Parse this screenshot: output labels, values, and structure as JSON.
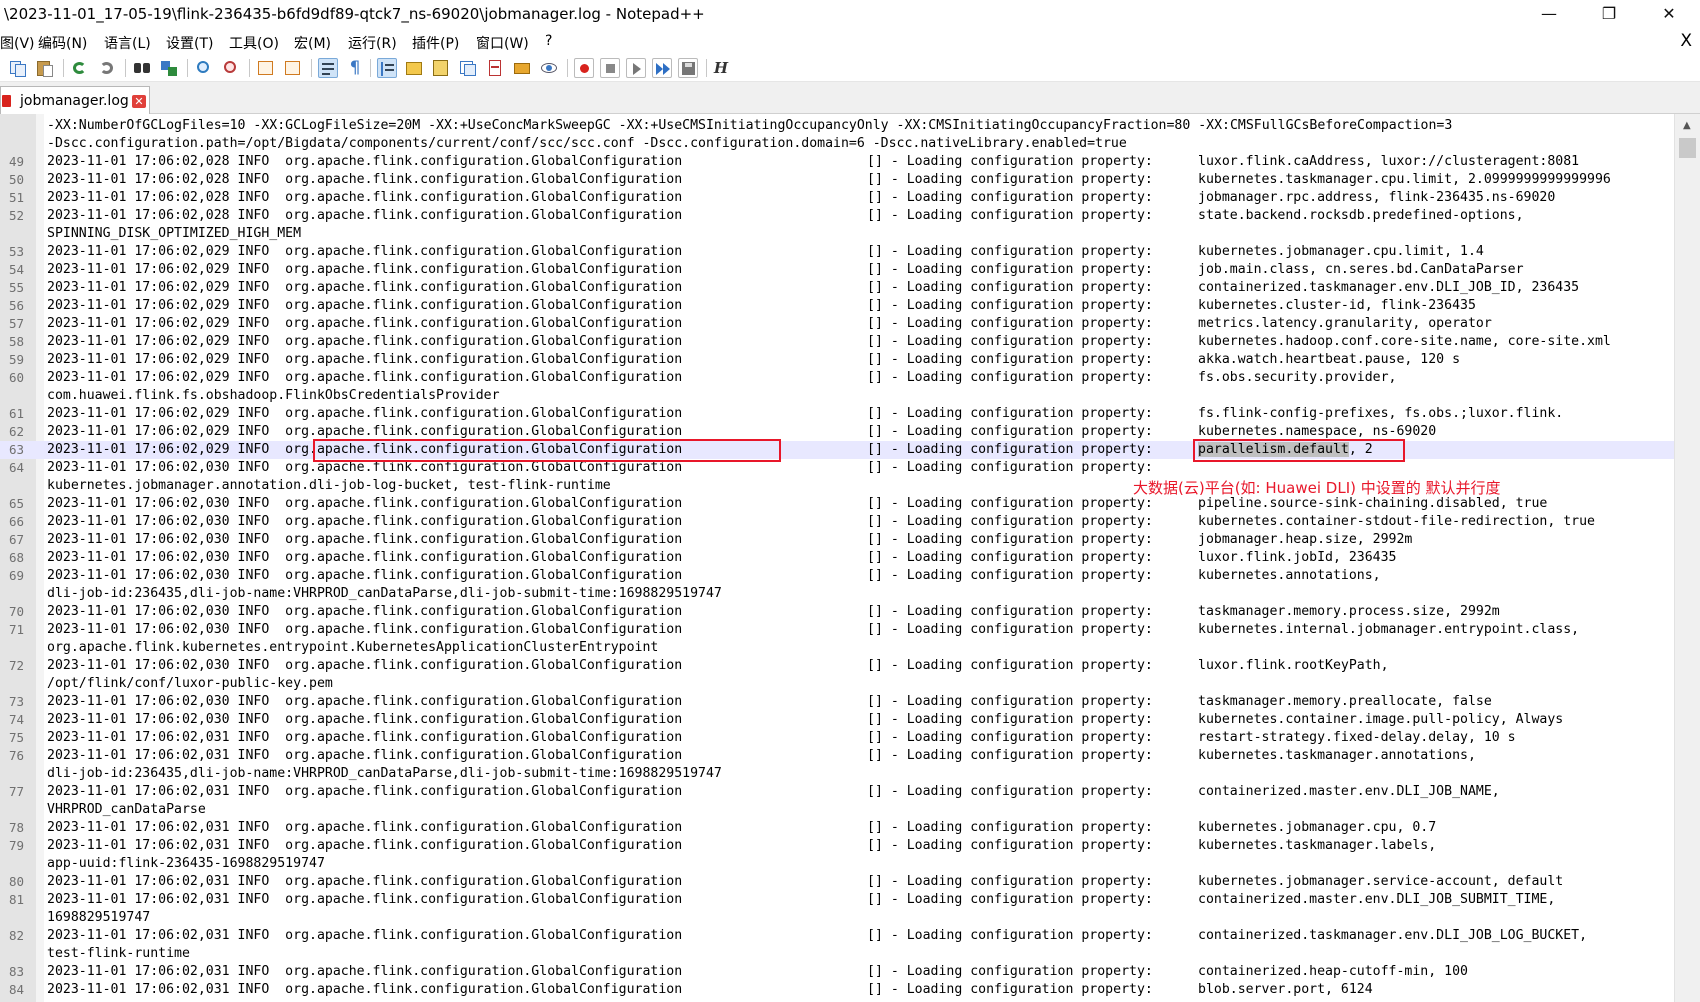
{
  "window": {
    "title": "\\2023-11-01_17-05-19\\flink-236435-b6fd9df89-qtck7_ns-69020\\jobmanager.log - Notepad++",
    "minimize_glyph": "—",
    "maximize_glyph": "❐",
    "close_glyph": "✕"
  },
  "menu": {
    "items": [
      "图(V)",
      "编码(N)",
      "语言(L)",
      "设置(T)",
      "工具(O)",
      "宏(M)",
      "运行(R)",
      "插件(P)",
      "窗口(W)",
      "?"
    ],
    "doc_close_glyph": "X"
  },
  "toolbar": {
    "icons": [
      "copy-icon",
      "paste-icon",
      "undo-icon",
      "redo-icon",
      "find-icon",
      "replace-icon",
      "zoom-in-icon",
      "zoom-out-icon",
      "sync-vertical-icon",
      "sync-horizontal-icon",
      "word-wrap-icon",
      "show-all-characters-icon",
      "indent-guide-icon",
      "user-defined-language-icon",
      "document-map-icon",
      "document-list-icon",
      "function-list-icon",
      "folder-as-workspace-icon",
      "monitoring-icon",
      "record-macro-icon",
      "stop-recording-icon",
      "playback-macro-icon",
      "run-macro-multiple-icon",
      "save-macro-icon",
      "hex-editor-icon"
    ],
    "hex_label": "H"
  },
  "tab": {
    "label": "jobmanager.log",
    "close_glyph": "✕"
  },
  "log": {
    "lines": [
      {
        "n": "",
        "text": "-XX:NumberOfGCLogFiles=10 -XX:GCLogFileSize=20M -XX:+UseConcMarkSweepGC -XX:+UseCMSInitiatingOccupancyOnly -XX:CMSInitiatingOccupancyFraction=80 -XX:CMSFullGCsBeforeCompaction=3"
      },
      {
        "n": "",
        "text": "-Dscc.configuration.path=/opt/Bigdata/components/current/conf/scc/scc.conf -Dscc.configuration.domain=6 -Dscc.nativeLibrary.enabled=true"
      },
      {
        "n": "49",
        "c1": "2023-11-01 17:06:02,028 INFO  org.apache.flink.configuration.GlobalConfiguration",
        "c2": "[] - Loading configuration property:",
        "c3": "luxor.flink.caAddress, luxor://clusteragent:8081"
      },
      {
        "n": "50",
        "c1": "2023-11-01 17:06:02,028 INFO  org.apache.flink.configuration.GlobalConfiguration",
        "c2": "[] - Loading configuration property:",
        "c3": "kubernetes.taskmanager.cpu.limit, 2.0999999999999996"
      },
      {
        "n": "51",
        "c1": "2023-11-01 17:06:02,028 INFO  org.apache.flink.configuration.GlobalConfiguration",
        "c2": "[] - Loading configuration property:",
        "c3": "jobmanager.rpc.address, flink-236435.ns-69020"
      },
      {
        "n": "52",
        "c1": "2023-11-01 17:06:02,028 INFO  org.apache.flink.configuration.GlobalConfiguration",
        "c2": "[] - Loading configuration property:",
        "c3": "state.backend.rocksdb.predefined-options,"
      },
      {
        "n": "",
        "text": "SPINNING_DISK_OPTIMIZED_HIGH_MEM"
      },
      {
        "n": "53",
        "c1": "2023-11-01 17:06:02,029 INFO  org.apache.flink.configuration.GlobalConfiguration",
        "c2": "[] - Loading configuration property:",
        "c3": "kubernetes.jobmanager.cpu.limit, 1.4"
      },
      {
        "n": "54",
        "c1": "2023-11-01 17:06:02,029 INFO  org.apache.flink.configuration.GlobalConfiguration",
        "c2": "[] - Loading configuration property:",
        "c3": "job.main.class, cn.seres.bd.CanDataParser"
      },
      {
        "n": "55",
        "c1": "2023-11-01 17:06:02,029 INFO  org.apache.flink.configuration.GlobalConfiguration",
        "c2": "[] - Loading configuration property:",
        "c3": "containerized.taskmanager.env.DLI_JOB_ID, 236435"
      },
      {
        "n": "56",
        "c1": "2023-11-01 17:06:02,029 INFO  org.apache.flink.configuration.GlobalConfiguration",
        "c2": "[] - Loading configuration property:",
        "c3": "kubernetes.cluster-id, flink-236435"
      },
      {
        "n": "57",
        "c1": "2023-11-01 17:06:02,029 INFO  org.apache.flink.configuration.GlobalConfiguration",
        "c2": "[] - Loading configuration property:",
        "c3": "metrics.latency.granularity, operator"
      },
      {
        "n": "58",
        "c1": "2023-11-01 17:06:02,029 INFO  org.apache.flink.configuration.GlobalConfiguration",
        "c2": "[] - Loading configuration property:",
        "c3": "kubernetes.hadoop.conf.core-site.name, core-site.xml"
      },
      {
        "n": "59",
        "c1": "2023-11-01 17:06:02,029 INFO  org.apache.flink.configuration.GlobalConfiguration",
        "c2": "[] - Loading configuration property:",
        "c3": "akka.watch.heartbeat.pause, 120 s"
      },
      {
        "n": "60",
        "c1": "2023-11-01 17:06:02,029 INFO  org.apache.flink.configuration.GlobalConfiguration",
        "c2": "[] - Loading configuration property:",
        "c3": "fs.obs.security.provider,"
      },
      {
        "n": "",
        "text": "com.huawei.flink.fs.obshadoop.FlinkObsCredentialsProvider"
      },
      {
        "n": "61",
        "c1": "2023-11-01 17:06:02,029 INFO  org.apache.flink.configuration.GlobalConfiguration",
        "c2": "[] - Loading configuration property:",
        "c3": "fs.flink-config-prefixes, fs.obs.;luxor.flink."
      },
      {
        "n": "62",
        "c1": "2023-11-01 17:06:02,029 INFO  org.apache.flink.configuration.GlobalConfiguration",
        "c2": "[] - Loading configuration property:",
        "c3": "kubernetes.namespace, ns-69020"
      },
      {
        "n": "63",
        "c1": "2023-11-01 17:06:02,029 INFO  org.apache.flink.configuration.GlobalConfiguration",
        "c2": "[] - Loading configuration property:",
        "c3_sel": "parallelism.default",
        "c3_rest": ", 2",
        "current": true
      },
      {
        "n": "64",
        "c1": "2023-11-01 17:06:02,030 INFO  org.apache.flink.configuration.GlobalConfiguration",
        "c2": "[] - Loading configuration property:",
        "c3": ""
      },
      {
        "n": "",
        "text": "kubernetes.jobmanager.annotation.dli-job-log-bucket, test-flink-runtime"
      },
      {
        "n": "65",
        "c1": "2023-11-01 17:06:02,030 INFO  org.apache.flink.configuration.GlobalConfiguration",
        "c2": "[] - Loading configuration property:",
        "c3": "pipeline.source-sink-chaining.disabled, true"
      },
      {
        "n": "66",
        "c1": "2023-11-01 17:06:02,030 INFO  org.apache.flink.configuration.GlobalConfiguration",
        "c2": "[] - Loading configuration property:",
        "c3": "kubernetes.container-stdout-file-redirection, true"
      },
      {
        "n": "67",
        "c1": "2023-11-01 17:06:02,030 INFO  org.apache.flink.configuration.GlobalConfiguration",
        "c2": "[] - Loading configuration property:",
        "c3": "jobmanager.heap.size, 2992m"
      },
      {
        "n": "68",
        "c1": "2023-11-01 17:06:02,030 INFO  org.apache.flink.configuration.GlobalConfiguration",
        "c2": "[] - Loading configuration property:",
        "c3": "luxor.flink.jobId, 236435"
      },
      {
        "n": "69",
        "c1": "2023-11-01 17:06:02,030 INFO  org.apache.flink.configuration.GlobalConfiguration",
        "c2": "[] - Loading configuration property:",
        "c3": "kubernetes.annotations,"
      },
      {
        "n": "",
        "text": "dli-job-id:236435,dli-job-name:VHRPROD_canDataParse,dli-job-submit-time:1698829519747"
      },
      {
        "n": "70",
        "c1": "2023-11-01 17:06:02,030 INFO  org.apache.flink.configuration.GlobalConfiguration",
        "c2": "[] - Loading configuration property:",
        "c3": "taskmanager.memory.process.size, 2992m"
      },
      {
        "n": "71",
        "c1": "2023-11-01 17:06:02,030 INFO  org.apache.flink.configuration.GlobalConfiguration",
        "c2": "[] - Loading configuration property:",
        "c3": "kubernetes.internal.jobmanager.entrypoint.class,"
      },
      {
        "n": "",
        "text": "org.apache.flink.kubernetes.entrypoint.KubernetesApplicationClusterEntrypoint"
      },
      {
        "n": "72",
        "c1": "2023-11-01 17:06:02,030 INFO  org.apache.flink.configuration.GlobalConfiguration",
        "c2": "[] - Loading configuration property:",
        "c3": "luxor.flink.rootKeyPath,"
      },
      {
        "n": "",
        "text": "/opt/flink/conf/luxor-public-key.pem"
      },
      {
        "n": "73",
        "c1": "2023-11-01 17:06:02,030 INFO  org.apache.flink.configuration.GlobalConfiguration",
        "c2": "[] - Loading configuration property:",
        "c3": "taskmanager.memory.preallocate, false"
      },
      {
        "n": "74",
        "c1": "2023-11-01 17:06:02,030 INFO  org.apache.flink.configuration.GlobalConfiguration",
        "c2": "[] - Loading configuration property:",
        "c3": "kubernetes.container.image.pull-policy, Always"
      },
      {
        "n": "75",
        "c1": "2023-11-01 17:06:02,031 INFO  org.apache.flink.configuration.GlobalConfiguration",
        "c2": "[] - Loading configuration property:",
        "c3": "restart-strategy.fixed-delay.delay, 10 s"
      },
      {
        "n": "76",
        "c1": "2023-11-01 17:06:02,031 INFO  org.apache.flink.configuration.GlobalConfiguration",
        "c2": "[] - Loading configuration property:",
        "c3": "kubernetes.taskmanager.annotations,"
      },
      {
        "n": "",
        "text": "dli-job-id:236435,dli-job-name:VHRPROD_canDataParse,dli-job-submit-time:1698829519747"
      },
      {
        "n": "77",
        "c1": "2023-11-01 17:06:02,031 INFO  org.apache.flink.configuration.GlobalConfiguration",
        "c2": "[] - Loading configuration property:",
        "c3": "containerized.master.env.DLI_JOB_NAME,"
      },
      {
        "n": "",
        "text": "VHRPROD_canDataParse"
      },
      {
        "n": "78",
        "c1": "2023-11-01 17:06:02,031 INFO  org.apache.flink.configuration.GlobalConfiguration",
        "c2": "[] - Loading configuration property:",
        "c3": "kubernetes.jobmanager.cpu, 0.7"
      },
      {
        "n": "79",
        "c1": "2023-11-01 17:06:02,031 INFO  org.apache.flink.configuration.GlobalConfiguration",
        "c2": "[] - Loading configuration property:",
        "c3": "kubernetes.taskmanager.labels,"
      },
      {
        "n": "",
        "text": "app-uuid:flink-236435-1698829519747"
      },
      {
        "n": "80",
        "c1": "2023-11-01 17:06:02,031 INFO  org.apache.flink.configuration.GlobalConfiguration",
        "c2": "[] - Loading configuration property:",
        "c3": "kubernetes.jobmanager.service-account, default"
      },
      {
        "n": "81",
        "c1": "2023-11-01 17:06:02,031 INFO  org.apache.flink.configuration.GlobalConfiguration",
        "c2": "[] - Loading configuration property:",
        "c3": "containerized.master.env.DLI_JOB_SUBMIT_TIME,"
      },
      {
        "n": "",
        "text": "1698829519747"
      },
      {
        "n": "82",
        "c1": "2023-11-01 17:06:02,031 INFO  org.apache.flink.configuration.GlobalConfiguration",
        "c2": "[] - Loading configuration property:",
        "c3": "containerized.taskmanager.env.DLI_JOB_LOG_BUCKET,"
      },
      {
        "n": "",
        "text": "test-flink-runtime"
      },
      {
        "n": "83",
        "c1": "2023-11-01 17:06:02,031 INFO  org.apache.flink.configuration.GlobalConfiguration",
        "c2": "[] - Loading configuration property:",
        "c3": "containerized.heap-cutoff-min, 100"
      },
      {
        "n": "84",
        "c1": "2023-11-01 17:06:02,031 INFO  org.apache.flink.configuration.GlobalConfiguration",
        "c2": "[] - Loading configuration property:",
        "c3": "blob.server.port, 6124"
      }
    ]
  },
  "annotation": {
    "text": "大数据(云)平台(如: Huawei DLI) 中设置的 默认并行度",
    "color": "#e8172a"
  },
  "colors": {
    "current_line": "#e8e8ff",
    "selection": "#c0c0c0",
    "gutter": "#e4e4e4"
  }
}
